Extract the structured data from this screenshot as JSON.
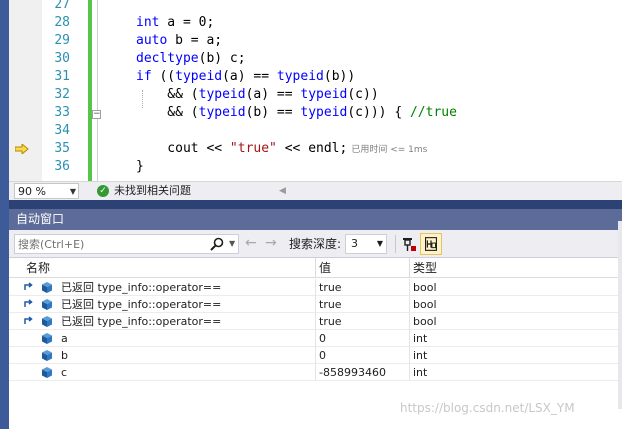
{
  "editor": {
    "lines": [
      {
        "number": "27",
        "segments": []
      },
      {
        "number": "28",
        "segments": [
          {
            "cls": "kw",
            "text": "int"
          },
          {
            "cls": "",
            "text": " a = 0;"
          }
        ]
      },
      {
        "number": "29",
        "segments": [
          {
            "cls": "kw",
            "text": "auto"
          },
          {
            "cls": "",
            "text": " b = a;"
          }
        ]
      },
      {
        "number": "30",
        "segments": [
          {
            "cls": "kw",
            "text": "decltype"
          },
          {
            "cls": "",
            "text": "(b) c;"
          }
        ]
      },
      {
        "number": "31",
        "segments": [
          {
            "cls": "kw",
            "text": "if"
          },
          {
            "cls": "",
            "text": " (("
          },
          {
            "cls": "kw",
            "text": "typeid"
          },
          {
            "cls": "",
            "text": "(a) == "
          },
          {
            "cls": "kw",
            "text": "typeid"
          },
          {
            "cls": "",
            "text": "(b))"
          }
        ]
      },
      {
        "number": "32",
        "segments": [
          {
            "cls": "",
            "text": "    && ("
          },
          {
            "cls": "kw",
            "text": "typeid"
          },
          {
            "cls": "",
            "text": "(a) == "
          },
          {
            "cls": "kw",
            "text": "typeid"
          },
          {
            "cls": "",
            "text": "(c))"
          }
        ]
      },
      {
        "number": "33",
        "segments": [
          {
            "cls": "",
            "text": "    && ("
          },
          {
            "cls": "kw",
            "text": "typeid"
          },
          {
            "cls": "",
            "text": "(b) == "
          },
          {
            "cls": "kw",
            "text": "typeid"
          },
          {
            "cls": "",
            "text": "(c))) { "
          },
          {
            "cls": "cmt",
            "text": "//true"
          }
        ]
      },
      {
        "number": "34",
        "segments": []
      },
      {
        "number": "35",
        "segments": [
          {
            "cls": "",
            "text": "    cout << "
          },
          {
            "cls": "str",
            "text": "\"true\""
          },
          {
            "cls": "",
            "text": " << endl;"
          }
        ],
        "hint": "已用时间 <= 1ms"
      },
      {
        "number": "36",
        "segments": [
          {
            "cls": "",
            "text": "}"
          }
        ]
      }
    ],
    "current_line": "35"
  },
  "statusbar": {
    "zoom": "90 %",
    "issues_text": "未找到相关问题"
  },
  "autos": {
    "title": "自动窗口",
    "search_placeholder": "搜索(Ctrl+E)",
    "depth_label": "搜索深度:",
    "depth_value": "3",
    "columns": {
      "name": "名称",
      "value": "值",
      "type": "类型"
    },
    "rows": [
      {
        "kind": "return",
        "prefix": "已返回",
        "name": "type_info::operator==",
        "value": "true",
        "type": "bool"
      },
      {
        "kind": "return",
        "prefix": "已返回",
        "name": "type_info::operator==",
        "value": "true",
        "type": "bool"
      },
      {
        "kind": "return",
        "prefix": "已返回",
        "name": "type_info::operator==",
        "value": "true",
        "type": "bool"
      },
      {
        "kind": "var",
        "prefix": "",
        "name": "a",
        "value": "0",
        "type": "int"
      },
      {
        "kind": "var",
        "prefix": "",
        "name": "b",
        "value": "0",
        "type": "int"
      },
      {
        "kind": "var",
        "prefix": "",
        "name": "c",
        "value": "-858993460",
        "type": "int"
      }
    ]
  },
  "watermark": "https://blog.csdn.net/LSX_YM",
  "colors": {
    "keyword": "#0000ff",
    "string": "#a31515",
    "comment": "#008000",
    "line_number": "#2b91af",
    "title_bar": "#5d6b99",
    "change_bar": "#57c44a"
  },
  "icons": {
    "exec_arrow": "current-statement-arrow-icon",
    "issues": "check-circle-icon",
    "search": "search-icon",
    "nav_back": "arrow-left-icon",
    "nav_forward": "arrow-right-icon",
    "pin": "pin-icon",
    "hex": "hex-display-icon",
    "return_value": "return-value-icon",
    "variable": "variable-cube-icon"
  }
}
